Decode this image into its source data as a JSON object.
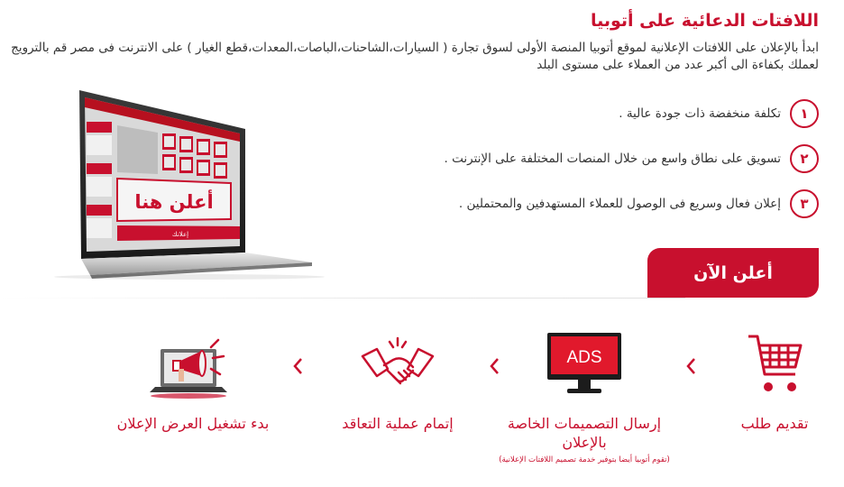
{
  "header": {
    "title": "اللافتات الدعائية على أتوبيا",
    "intro": "ابدأ بالإعلان على اللافتات الإعلانية لموقع أتوبيا المنصة الأولى لسوق تجارة ( السيارات،الشاحنات،الباصات،المعدات،قطع الغيار ) على الانترنت فى مصر قم بالترويج لعملك بكفاءة الى أكبر عدد من العملاء على مستوى البلد"
  },
  "laptop": {
    "ad_text": "أعلن هنا",
    "small_label": "إعلانك"
  },
  "features": [
    {
      "number": "١",
      "text": "تكلفة منخفضة ذات جودة عالية ."
    },
    {
      "number": "٢",
      "text": "تسويق على نطاق واسع من خلال المنصات المختلفة على الإنترنت ."
    },
    {
      "number": "٣",
      "text": "إعلان فعال وسريع فى الوصول للعملاء المستهدفين والمحتملين ."
    }
  ],
  "cta": {
    "label": "أعلن الآن"
  },
  "steps": [
    {
      "label": "تقديم طلب",
      "icon": "shopping-cart-icon"
    },
    {
      "label": "إرسال التصميمات الخاصة بالإعلان",
      "note": "(تقوم أتوبيا أيضا بتوفير خدمة تصميم اللافتات الإعلانية)",
      "icon": "ads-monitor-icon",
      "screen_text": "ADS"
    },
    {
      "label": "إتمام عملية التعاقد",
      "icon": "handshake-icon"
    },
    {
      "label": "بدء تشغيل العرض الإعلان",
      "icon": "megaphone-laptop-icon"
    }
  ],
  "colors": {
    "accent": "#c8102e",
    "text": "#333333"
  }
}
